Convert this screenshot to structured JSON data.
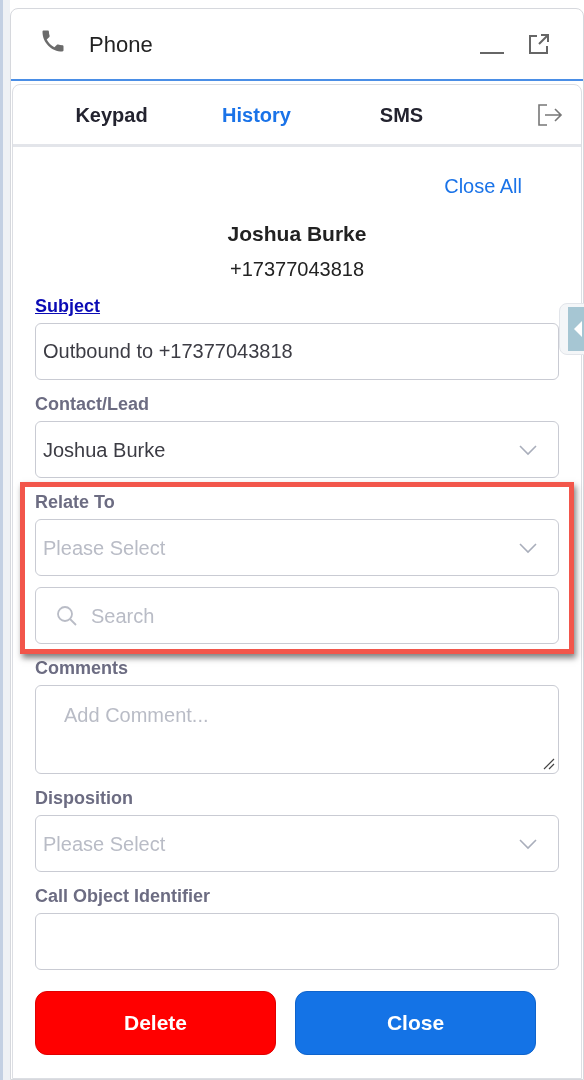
{
  "window": {
    "title": "Phone"
  },
  "tabs": [
    {
      "label": "Keypad",
      "selected": false
    },
    {
      "label": "History",
      "selected": true
    },
    {
      "label": "SMS",
      "selected": false
    }
  ],
  "close_all": "Close All",
  "contact": {
    "name": "Joshua Burke",
    "phone": "+17377043818"
  },
  "fields": [
    {
      "kind": "text",
      "label": "Subject",
      "link": true,
      "value": "Outbound to +17377043818",
      "highlighted": false
    },
    {
      "kind": "select",
      "label": "Contact/Lead",
      "link": false,
      "value": "Joshua Burke",
      "highlighted": false
    },
    {
      "kind": "select",
      "label": "Relate To",
      "link": false,
      "placeholder": "Please Select",
      "highlighted": true
    },
    {
      "kind": "search",
      "placeholder": "Search",
      "highlighted": true
    },
    {
      "kind": "textarea",
      "label": "Comments",
      "link": false,
      "placeholder": "Add Comment...",
      "highlighted": false
    },
    {
      "kind": "select",
      "label": "Disposition",
      "link": false,
      "placeholder": "Please Select",
      "highlighted": false
    },
    {
      "kind": "text",
      "label": "Call Object Identifier",
      "link": false,
      "highlighted": false
    }
  ],
  "buttons": [
    {
      "kind": "danger",
      "label": "Delete"
    },
    {
      "kind": "primary",
      "label": "Close"
    }
  ]
}
